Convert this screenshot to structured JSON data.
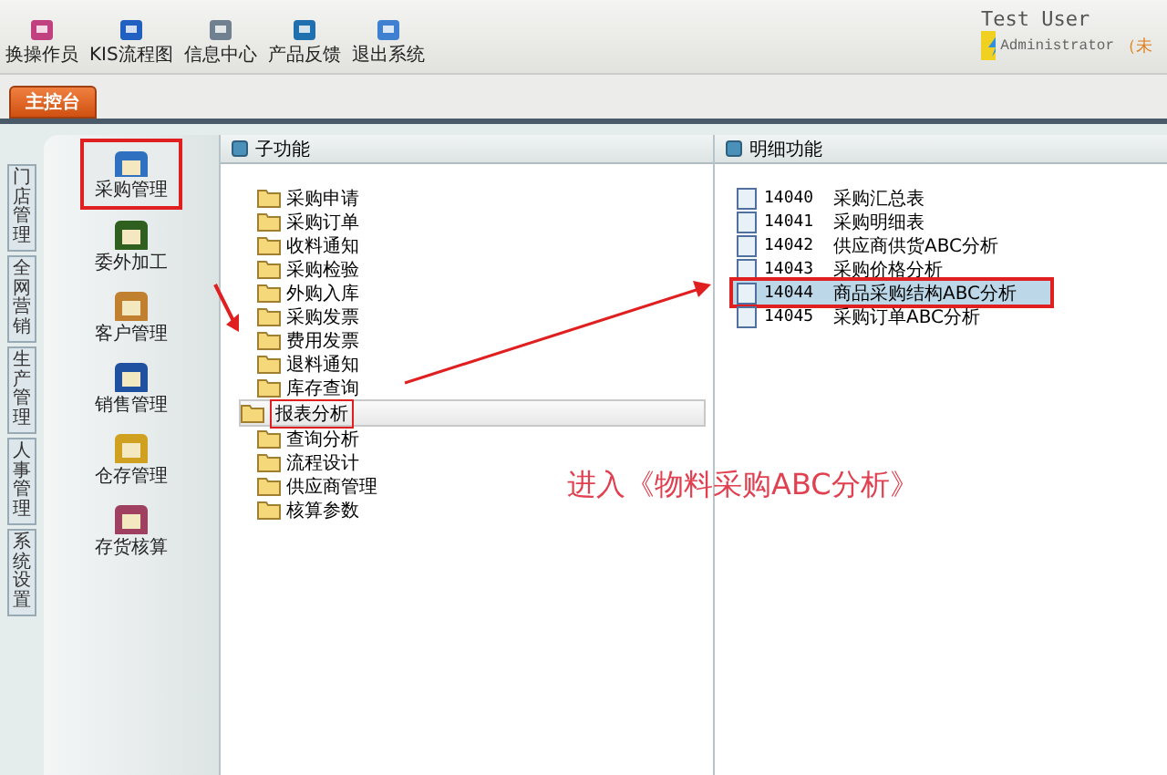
{
  "toolbar": [
    {
      "label": "换操作员",
      "kind": "users"
    },
    {
      "label": "KIS流程图",
      "kind": "flow"
    },
    {
      "label": "信息中心",
      "kind": "info"
    },
    {
      "label": "产品反馈",
      "kind": "feedback"
    },
    {
      "label": "退出系统",
      "kind": "exit"
    }
  ],
  "user": {
    "name": "Test User",
    "role": "Administrator",
    "status": "（未"
  },
  "tabs": [
    {
      "label": "主控台",
      "selected": true
    }
  ],
  "side_tabs": [
    "门店管理",
    "全网营销",
    "生产管理",
    "人事管理",
    "系统设置"
  ],
  "modules": [
    {
      "label": "采购管理",
      "kind": "purchase",
      "selected": true
    },
    {
      "label": "委外加工",
      "kind": "outsource",
      "selected": false
    },
    {
      "label": "客户管理",
      "kind": "customer",
      "selected": false
    },
    {
      "label": "销售管理",
      "kind": "sales",
      "selected": false
    },
    {
      "label": "仓存管理",
      "kind": "warehouse",
      "selected": false
    },
    {
      "label": "存货核算",
      "kind": "inventory",
      "selected": false
    }
  ],
  "sub_panel": {
    "title": "子功能",
    "items": [
      {
        "label": "采购申请",
        "selected": false
      },
      {
        "label": "采购订单",
        "selected": false
      },
      {
        "label": "收料通知",
        "selected": false
      },
      {
        "label": "采购检验",
        "selected": false
      },
      {
        "label": "外购入库",
        "selected": false
      },
      {
        "label": "采购发票",
        "selected": false
      },
      {
        "label": "费用发票",
        "selected": false
      },
      {
        "label": "退料通知",
        "selected": false
      },
      {
        "label": "库存查询",
        "selected": false
      },
      {
        "label": "报表分析",
        "selected": true
      },
      {
        "label": "查询分析",
        "selected": false
      },
      {
        "label": "流程设计",
        "selected": false
      },
      {
        "label": "供应商管理",
        "selected": false
      },
      {
        "label": "核算参数",
        "selected": false
      }
    ]
  },
  "detail_panel": {
    "title": "明细功能",
    "items": [
      {
        "code": "14040",
        "label": "采购汇总表",
        "selected": false
      },
      {
        "code": "14041",
        "label": "采购明细表",
        "selected": false
      },
      {
        "code": "14042",
        "label": "供应商供货ABC分析",
        "selected": false
      },
      {
        "code": "14043",
        "label": "采购价格分析",
        "selected": false
      },
      {
        "code": "14044",
        "label": "商品采购结构ABC分析",
        "selected": true
      },
      {
        "code": "14045",
        "label": "采购订单ABC分析",
        "selected": false
      }
    ]
  },
  "annotation": "进入《物料采购ABC分析》"
}
